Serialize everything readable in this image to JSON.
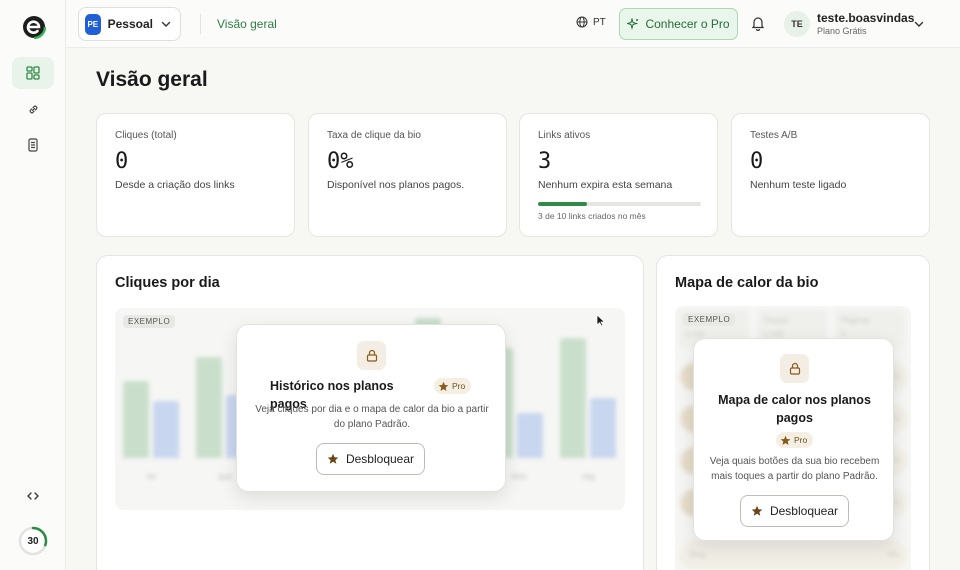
{
  "sidebar": {
    "logo": "e-logo-icon",
    "items": [
      {
        "name": "dashboard",
        "icon": "grid-icon",
        "active": true
      },
      {
        "name": "links",
        "icon": "link-icon",
        "active": false
      },
      {
        "name": "documents",
        "icon": "document-icon",
        "active": false
      }
    ],
    "bottom_icon": "code-icon",
    "progress": {
      "value": "30",
      "fraction": 0.3
    }
  },
  "header": {
    "workspace": {
      "badge": "PE",
      "name": "Pessoal"
    },
    "breadcrumb": "Visão geral",
    "language": "PT",
    "pro_button": "Conhecer o Pro",
    "user": {
      "initials": "TE",
      "name": "teste.boasvindas",
      "plan": "Plano Grátis"
    }
  },
  "main": {
    "title": "Visão geral",
    "stats": [
      {
        "label": "Cliques (total)",
        "value": "0",
        "sub": "Desde a criação dos links"
      },
      {
        "label": "Taxa de clique da bio",
        "value": "0%",
        "sub": "Disponível nos planos pagos."
      },
      {
        "label": "Links ativos",
        "value": "3",
        "sub": "Nenhum expira esta semana",
        "note": "3 de 10 links criados no mês",
        "progress": 0.3
      },
      {
        "label": "Testes A/B",
        "value": "0",
        "sub": "Nenhum teste ligado"
      }
    ],
    "clicks_panel": {
      "title": "Cliques por dia",
      "tag": "EXEMPLO",
      "x_labels": [
        "ter",
        "qua",
        "",
        "",
        "",
        "dom",
        "seg"
      ],
      "modal": {
        "title": "Histórico nos planos pagos",
        "pro": "Pro",
        "desc": "Veja cliques por dia e o mapa de calor da bio a partir do plano Padrão.",
        "button": "Desbloquear"
      }
    },
    "heatmap_panel": {
      "title": "Mapa de calor da bio",
      "tag": "EXEMPLO",
      "bg_cards": [
        {
          "label": "",
          "value": "4.200"
        },
        {
          "label": "Toques",
          "value": "1.248"
        },
        {
          "label": "Páginas",
          "value": "3"
        }
      ],
      "bg_rows": [
        {
          "label": "",
          "pct": "%"
        },
        {
          "label": "",
          "pct": "%"
        },
        {
          "label": "",
          "pct": "%"
        },
        {
          "label": "",
          "pct": "%"
        },
        {
          "label": "Blog",
          "pct": "5%"
        }
      ],
      "modal": {
        "title": "Mapa de calor nos planos pagos",
        "pro": "Pro",
        "desc": "Veja quais botões da sua bio recebem mais toques a partir do plano Padrão.",
        "button": "Desbloquear"
      }
    }
  },
  "colors": {
    "accent_green": "#2e8b46",
    "brand_blue": "#1f5fd8",
    "pro_star": "#8a5a1c"
  }
}
